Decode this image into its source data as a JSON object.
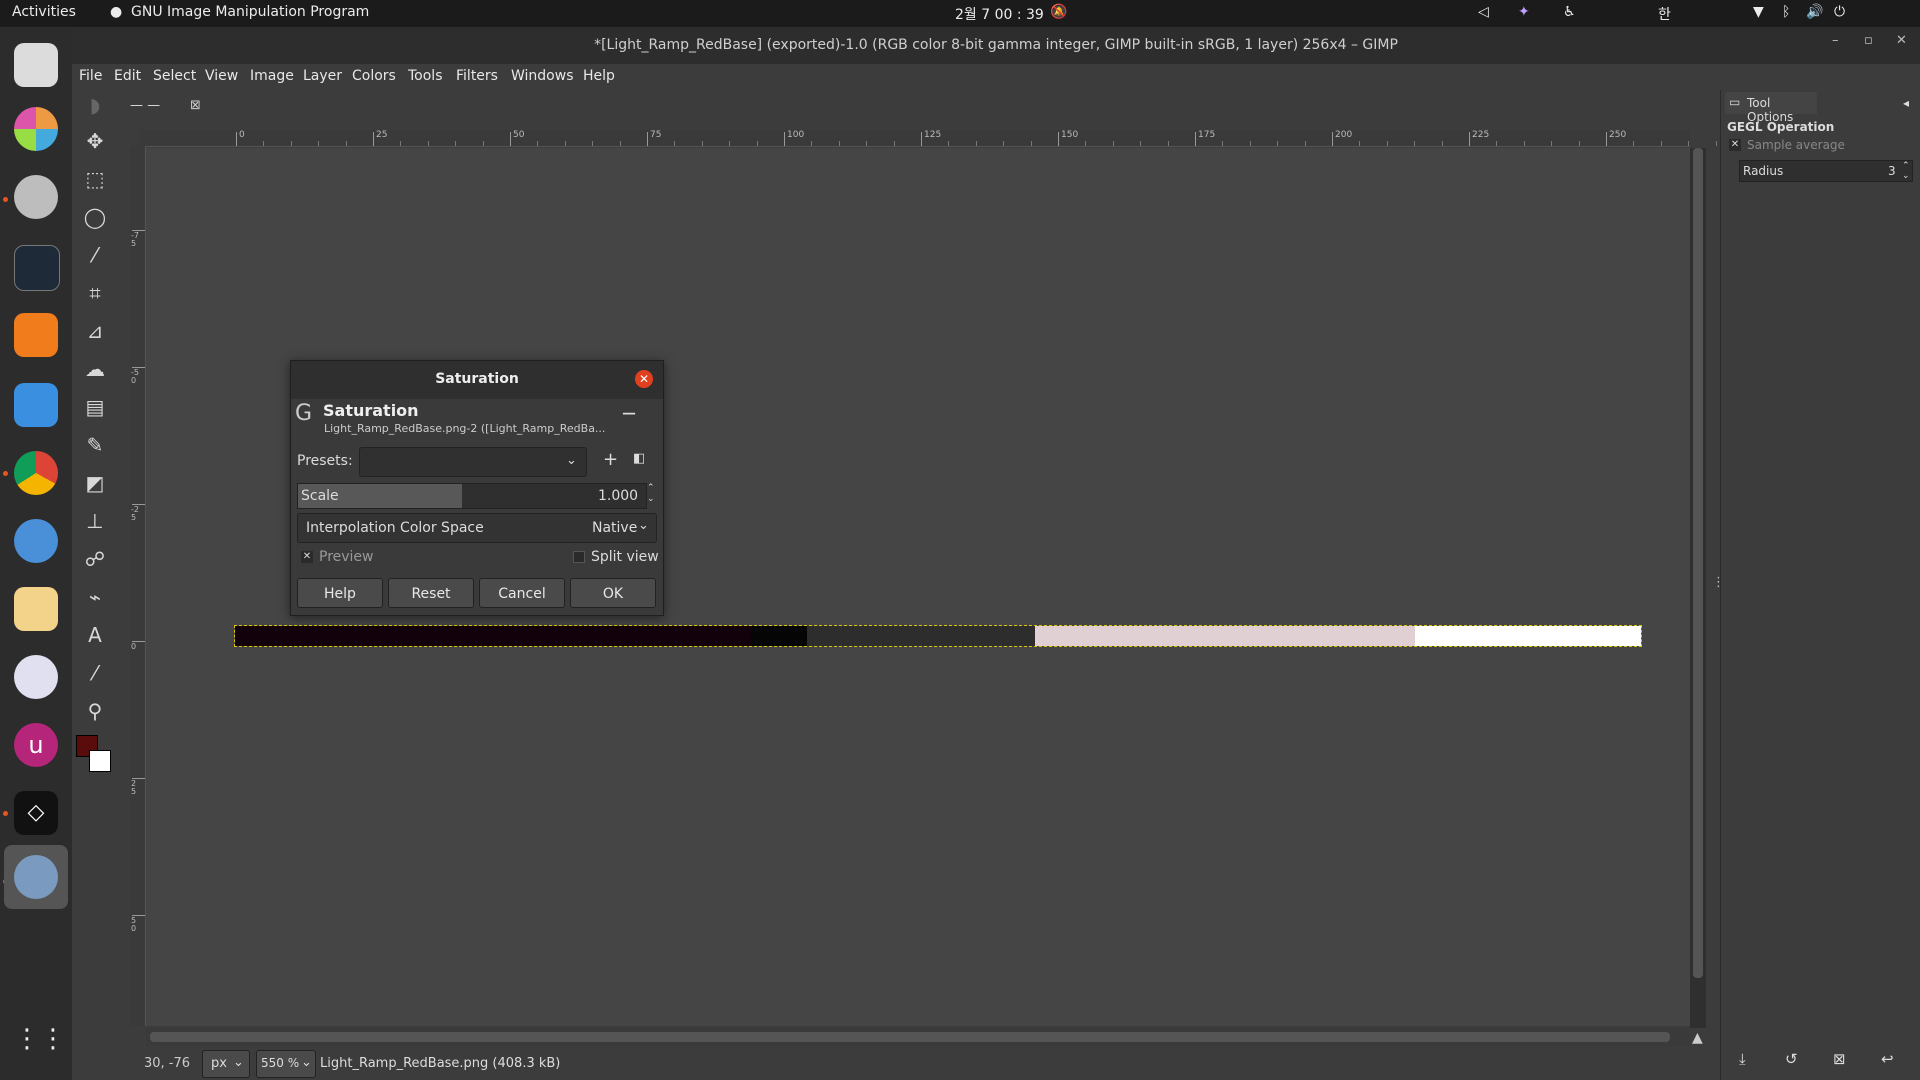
{
  "topbar": {
    "activities": "Activities",
    "app_name": "GNU Image Manipulation Program",
    "clock": "2월 7  00 : 39",
    "input_method": "한"
  },
  "window": {
    "title": "*[Light_Ramp_RedBase] (exported)-1.0 (RGB color 8-bit gamma integer, GIMP built-in sRGB, 1 layer) 256x4 – GIMP"
  },
  "menu": [
    "File",
    "Edit",
    "Select",
    "View",
    "Image",
    "Layer",
    "Colors",
    "Tools",
    "Filters",
    "Windows",
    "Help"
  ],
  "ruler": {
    "top_ticks": [
      "0",
      "25",
      "50",
      "75",
      "100",
      "125",
      "150",
      "175",
      "200",
      "225",
      "250"
    ],
    "left_ticks": [
      "-75",
      "-50",
      "-25",
      "0",
      "25",
      "50"
    ]
  },
  "dialog": {
    "window_title": "Saturation",
    "header_title": "Saturation",
    "header_subtitle": "Light_Ramp_RedBase.png-2 ([Light_Ramp_RedBa...",
    "presets_label": "Presets:",
    "presets_value": "",
    "scale_label": "Scale",
    "scale_value": "1.000",
    "scale_fraction": 0.47,
    "interp_label": "Interpolation Color Space",
    "interp_value": "Native",
    "preview_label": "Preview",
    "preview_checked": true,
    "split_label": "Split view",
    "split_checked": false,
    "buttons": {
      "help": "Help",
      "reset": "Reset",
      "cancel": "Cancel",
      "ok": "OK"
    }
  },
  "tool_options": {
    "tab_label": "Tool Options",
    "section": "GEGL Operation",
    "sample_average_label": "Sample average",
    "radius_label": "Radius",
    "radius_value": "3"
  },
  "status": {
    "coords": "30, -76",
    "unit": "px",
    "zoom": "550 %",
    "file_info": "Light_Ramp_RedBase.png (408.3 kB)"
  },
  "colors": {
    "foreground": "#5a0c0c",
    "background": "#ffffff",
    "segments": [
      "#12000a",
      "#050505",
      "#2d2d2d",
      "#e0d0d4",
      "#ffffff"
    ]
  }
}
